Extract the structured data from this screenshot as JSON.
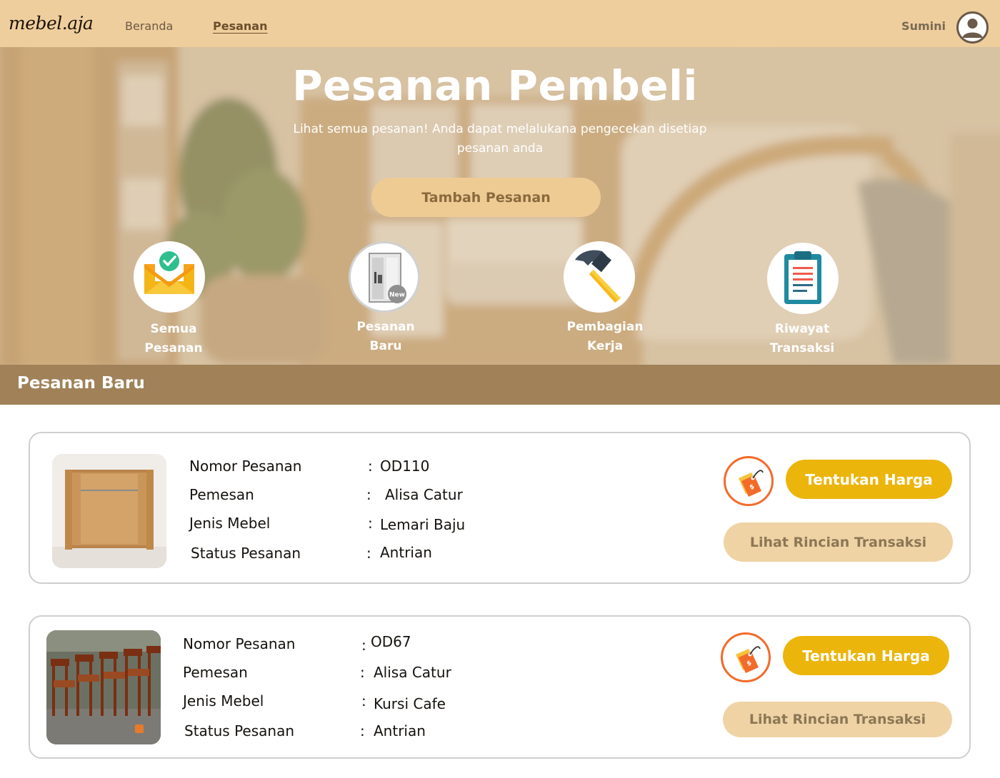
{
  "nav": {
    "logo": "mebel.aja",
    "home": "Beranda",
    "orders": "Pesanan",
    "user_name": "Sumini"
  },
  "hero": {
    "title": "Pesanan Pembeli",
    "subtitle": "Lihat semua pesanan! Anda dapat melalukana pengecekan disetiap pesanan anda",
    "add_button": "Tambah Pesanan"
  },
  "categories": [
    {
      "label_line1": "Semua",
      "label_line2": "Pesanan",
      "icon": "envelope-check-icon"
    },
    {
      "label_line1": "Pesanan",
      "label_line2": "Baru",
      "icon": "new-wardrobe-icon",
      "badge": "New"
    },
    {
      "label_line1": "Pembagian",
      "label_line2": "Kerja",
      "icon": "hammer-icon"
    },
    {
      "label_line1": "Riwayat",
      "label_line2": "Transaksi",
      "icon": "clipboard-icon"
    }
  ],
  "section": {
    "title": "Pesanan Baru"
  },
  "field_labels": {
    "order_no": "Nomor Pesanan",
    "buyer": "Pemesan",
    "type": "Jenis Mebel",
    "status": "Status Pesanan",
    "colon": ":"
  },
  "orders": [
    {
      "order_no": "OD110",
      "buyer": "Alisa Catur",
      "type": "Lemari Baju",
      "status": "Antrian",
      "price_button": "Tentukan Harga",
      "detail_button": "Lihat Rincian Transaksi"
    },
    {
      "order_no": "OD67",
      "buyer": "Alisa Catur",
      "type": "Kursi Cafe",
      "status": "Antrian",
      "price_button": "Tentukan Harga",
      "detail_button": "Lihat Rincian Transaksi"
    }
  ],
  "colors": {
    "navbar": "#efce9d",
    "section_bar": "#a08158",
    "price_button": "#ebb50c",
    "detail_button": "#efd3a4",
    "tag_ring": "#f26b2a"
  }
}
